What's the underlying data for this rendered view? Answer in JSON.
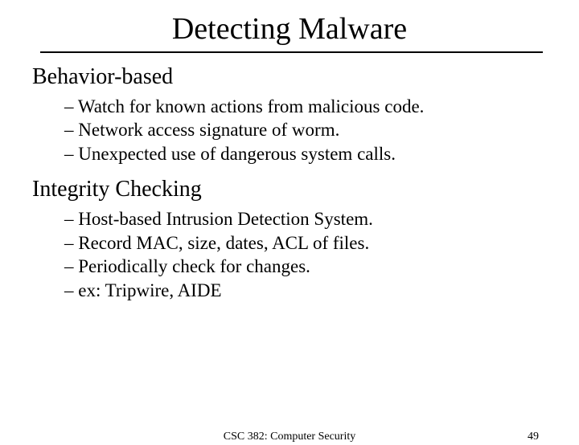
{
  "title": "Detecting Malware",
  "sections": [
    {
      "heading": "Behavior-based",
      "items": [
        "Watch for known actions from malicious code.",
        "Network access signature of worm.",
        "Unexpected use of dangerous system calls."
      ]
    },
    {
      "heading": "Integrity Checking",
      "items": [
        "Host-based Intrusion Detection System.",
        "Record MAC, size, dates, ACL of files.",
        "Periodically check for changes.",
        "ex: Tripwire, AIDE"
      ]
    }
  ],
  "footer": {
    "center": "CSC 382: Computer Security",
    "page": "49"
  }
}
